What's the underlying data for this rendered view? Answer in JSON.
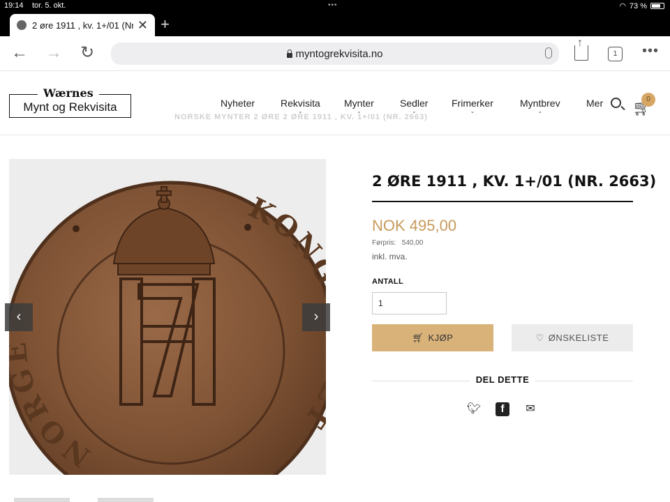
{
  "status_bar": {
    "time": "19:14",
    "date": "tor. 5. okt.",
    "battery": "73 %",
    "battery_level": 0.73
  },
  "browser": {
    "tab_title": "2 øre 1911 , kv. 1+/01 (Nr.",
    "url": "myntogrekvisita.no",
    "tab_count": "1"
  },
  "site": {
    "logo_brand": "Wærnes",
    "logo_sub": "Mynt og Rekvisita",
    "ghost_breadcrumb": "NORSKE MYNTER    2 ØRE    2 ØRE 1911 , KV. 1+/01 (NR. 2663)",
    "nav": [
      "Nyheter",
      "Rekvisita",
      "Mynter",
      "Sedler",
      "Frimerker",
      "Myntbrev",
      "Mer"
    ],
    "cart_count": "0"
  },
  "product": {
    "title": "2 ØRE 1911 , KV. 1+/01 (NR. 2663)",
    "price": "NOK 495,00",
    "previous_price_label": "Førpris:",
    "previous_price": "540,00",
    "vat_note": "inkl. mva.",
    "quantity_label": "ANTALL",
    "quantity_value": "1",
    "buy_label": "KJØP",
    "wishlist_label": "ØNSKELISTE",
    "share_label": "DEL DETTE",
    "coin_legend_left": "NORGE",
    "coin_legend_right": "KONGERIKET"
  },
  "colors": {
    "accent": "#c79a5a",
    "buy_button": "#d9b27a",
    "coin": "#8a5a3a"
  }
}
